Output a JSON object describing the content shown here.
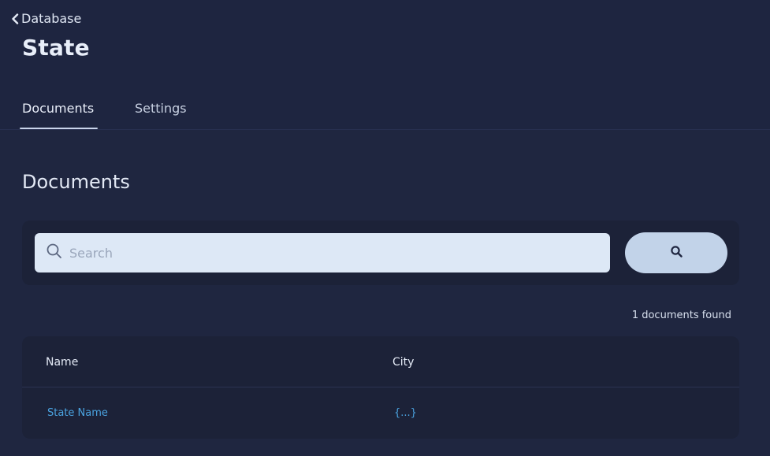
{
  "breadcrumb": {
    "back_label": "Database"
  },
  "page": {
    "title": "State"
  },
  "tabs": [
    {
      "label": "Documents",
      "active": true
    },
    {
      "label": "Settings",
      "active": false
    }
  ],
  "section": {
    "title": "Documents"
  },
  "search": {
    "placeholder": "Search",
    "value": "",
    "button_icon": "search-icon"
  },
  "results": {
    "count_text": "1 documents found"
  },
  "table": {
    "columns": [
      "Name",
      "City"
    ],
    "rows": [
      {
        "name": "State Name",
        "city": "{...}"
      }
    ]
  },
  "colors": {
    "background": "#1f2640",
    "accent_link": "#4aa3e0",
    "search_field": "#dde8f6",
    "search_button": "#c2d3e9"
  }
}
